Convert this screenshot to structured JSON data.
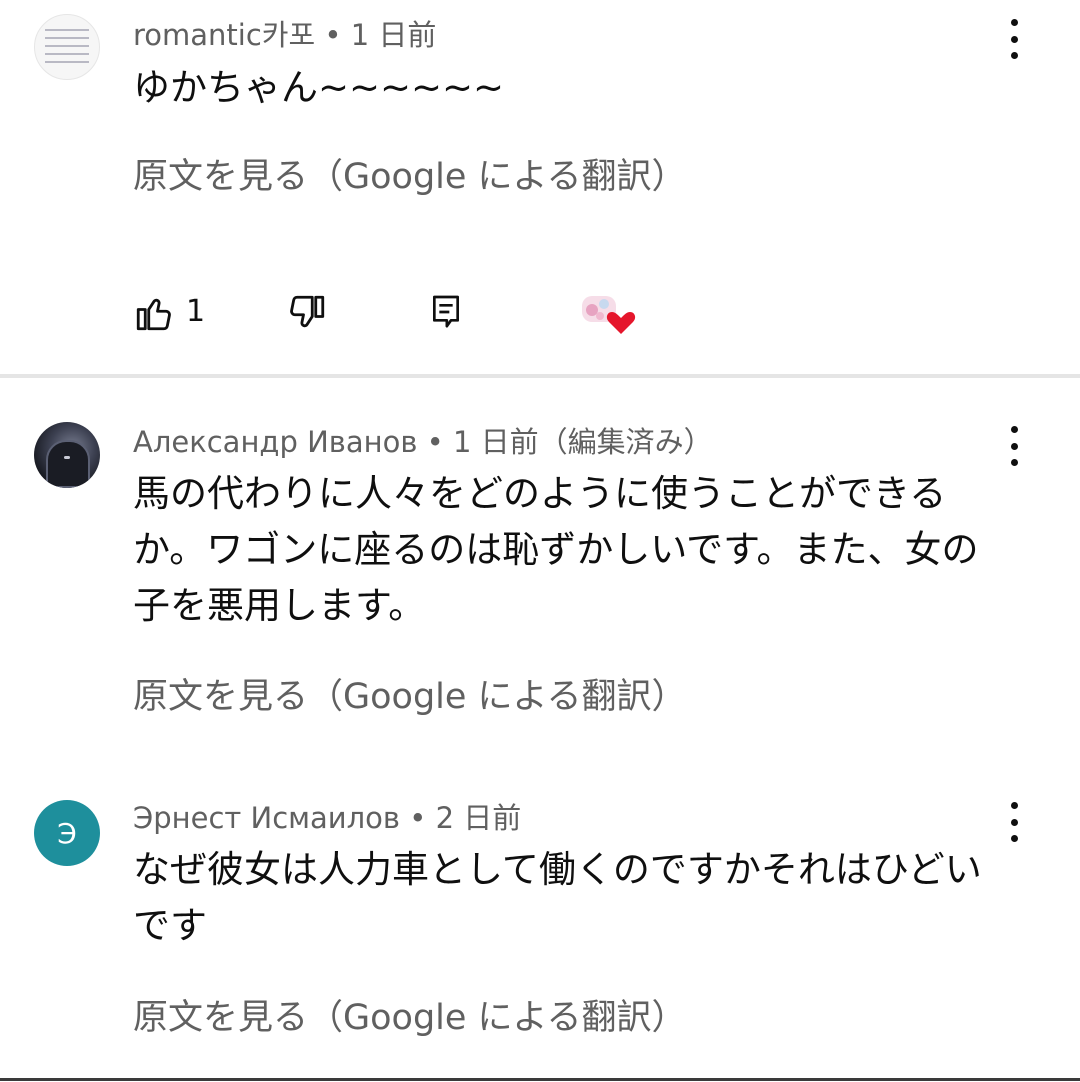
{
  "comments": [
    {
      "author": "romantic카포",
      "time": "1 日前",
      "edited": "",
      "text": "ゆかちゃん~~~~~~",
      "translate_label": "原文を見る（Google による翻訳）",
      "like_count": "1",
      "avatar": "sheet-music-avatar"
    },
    {
      "author": "Александр Иванов",
      "time": "1 日前",
      "edited": "（編集済み）",
      "text": "馬の代わりに人々をどのように使うことができるか。ワゴンに座るのは恥ずかしいです。また、女の子を悪用します。",
      "translate_label": "原文を見る（Google による翻訳）",
      "avatar": "hooded-figure-avatar"
    },
    {
      "author": "Эрнест Исмаилов",
      "time": "2 日前",
      "edited": "",
      "text": "なぜ彼女は人力車として働くのですかそれはひどいです",
      "translate_label": "原文を見る（Google による翻訳）",
      "avatar_letter": "Э"
    }
  ],
  "separator": " • ",
  "icons": {
    "like": "thumbs-up-icon",
    "dislike": "thumbs-down-icon",
    "reply": "reply-icon",
    "creator_heart": "creator-heart-icon",
    "more": "more-vert-icon"
  },
  "colors": {
    "meta_text": "#606060",
    "heart": "#e5162c",
    "avatar_letter_bg": "#1e8f9c"
  }
}
